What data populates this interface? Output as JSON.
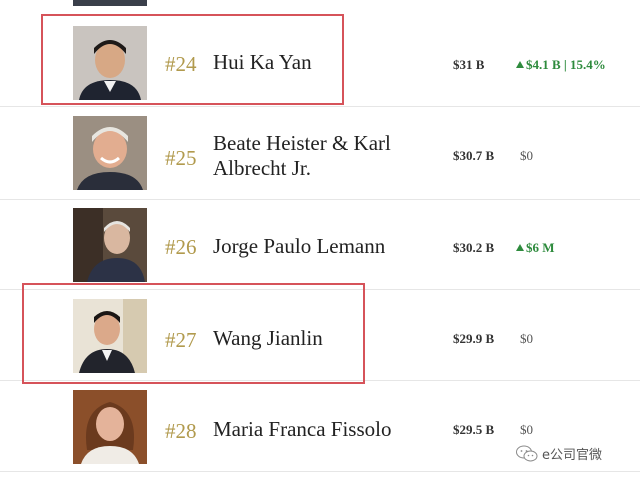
{
  "rows": [
    {
      "rank": "#24",
      "name": "Hui Ka Yan",
      "net_worth": "$31 B",
      "change": "$4.1 B | 15.4%",
      "change_direction": "up",
      "highlighted": true
    },
    {
      "rank": "#25",
      "name_line1": "Beate Heister & Karl",
      "name_line2": "Albrecht Jr.",
      "net_worth": "$30.7 B",
      "change": "$0",
      "change_direction": "none",
      "highlighted": false
    },
    {
      "rank": "#26",
      "name": "Jorge Paulo Lemann",
      "net_worth": "$30.2 B",
      "change": "$6 M",
      "change_direction": "up",
      "highlighted": false
    },
    {
      "rank": "#27",
      "name": "Wang Jianlin",
      "net_worth": "$29.9 B",
      "change": "$0",
      "change_direction": "none",
      "highlighted": true
    },
    {
      "rank": "#28",
      "name": "Maria Franca Fissolo",
      "net_worth": "$29.5 B",
      "change": "$0",
      "change_direction": "none",
      "highlighted": false
    }
  ],
  "colors": {
    "rank": "#b19a4d",
    "gain": "#2e8b3d",
    "highlight": "#d6535a"
  },
  "watermark": {
    "text": "e公司官微",
    "icon": "wechat-icon"
  }
}
